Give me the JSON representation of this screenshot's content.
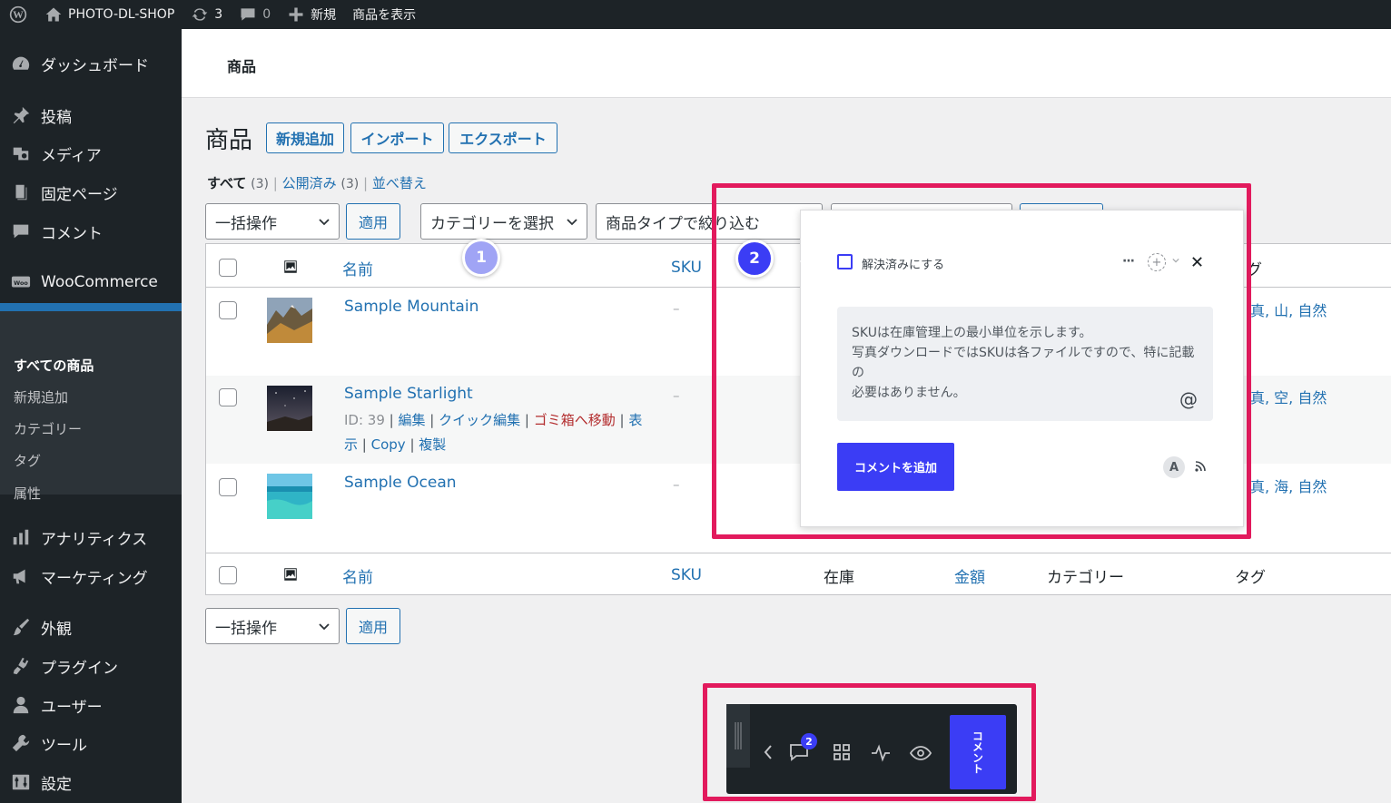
{
  "admin_bar": {
    "site_name": "PHOTO-DL-SHOP",
    "updates_count": "3",
    "comments_count": "0",
    "new_label": "新規",
    "view_products_label": "商品を表示"
  },
  "sidebar": {
    "dashboard": "ダッシュボード",
    "posts": "投稿",
    "media": "メディア",
    "pages": "固定ページ",
    "comments": "コメント",
    "woocommerce": "WooCommerce",
    "products": "商品",
    "submenu": {
      "all_products": "すべての商品",
      "add_new": "新規追加",
      "categories": "カテゴリー",
      "tags": "タグ",
      "attributes": "属性"
    },
    "analytics": "アナリティクス",
    "marketing": "マーケティング",
    "appearance": "外観",
    "plugins": "プラグイン",
    "users": "ユーザー",
    "tools": "ツール",
    "settings": "設定"
  },
  "header": {
    "title": "商品"
  },
  "page": {
    "title": "商品",
    "add_new": "新規追加",
    "import": "インポート",
    "export": "エクスポート"
  },
  "filters": {
    "all": "すべて",
    "all_count": "(3)",
    "published": "公開済み",
    "published_count": "(3)",
    "sort": "並べ替え",
    "separator": "|"
  },
  "tablenav": {
    "bulk_action": "一括操作",
    "apply": "適用",
    "category_select": "カテゴリーを選択",
    "type_filter": "商品タイプで絞り込む"
  },
  "table": {
    "columns": {
      "name": "名前",
      "sku": "SKU",
      "stock": "在庫",
      "price": "金額",
      "categories": "カテゴリー",
      "tags": "タグ"
    },
    "header_tags_partial": "グ",
    "rows": [
      {
        "name": "Sample Mountain",
        "sku": "–",
        "tags": "真, 山, 自然"
      },
      {
        "name": "Sample Starlight",
        "sku": "–",
        "tags": "真, 空, 自然",
        "row_actions": {
          "id": "ID: 39",
          "edit": "編集",
          "quick_edit": "クイック編集",
          "trash": "ゴミ箱へ移動",
          "view_part1": "表",
          "view_part2": "示",
          "copy": "Copy",
          "duplicate": "複製"
        }
      },
      {
        "name": "Sample Ocean",
        "sku": "–",
        "tags": "真, 海, 自然"
      }
    ]
  },
  "comment_popup": {
    "marker1": "1",
    "marker2": "2",
    "resolve_label": "解決済みにする",
    "comment_line1": "SKUは在庫管理上の最小単位を示します。",
    "comment_line2": "写真ダウンロードではSKUは各ファイルですので、特に記載の",
    "comment_line3": "必要はありません。",
    "at_symbol": "@",
    "add_comment_button": "コメントを追加",
    "avatar_letter": "A"
  },
  "toolbar": {
    "comment_badge": "2",
    "comment_tab": "コメント"
  },
  "colors": {
    "admin_dark": "#1d2327",
    "wp_blue": "#2271b1",
    "highlight_pink": "#e21a5d",
    "accent_indigo": "#3b3df5",
    "marker1": "#a0a4f5",
    "marker2": "#3b3df5"
  }
}
